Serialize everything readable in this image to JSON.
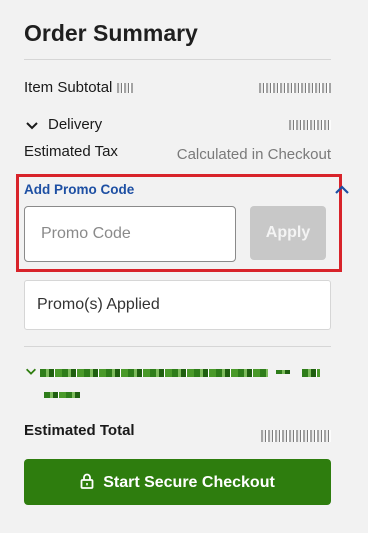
{
  "summary": {
    "title": "Order Summary",
    "item_subtotal_label": "Item Subtotal",
    "delivery_label": "Delivery",
    "estimated_tax_label": "Estimated Tax",
    "estimated_tax_value": "Calculated in Checkout"
  },
  "promo": {
    "title": "Add Promo Code",
    "input_placeholder": "Promo Code",
    "input_value": "",
    "apply_label": "Apply",
    "applied_label": "Promo(s) Applied"
  },
  "total": {
    "label": "Estimated Total"
  },
  "checkout": {
    "label": "Start Secure Checkout"
  },
  "icons": {
    "delivery_toggle": "chevron-down-icon",
    "promo_toggle": "chevron-up-icon",
    "rewards_toggle": "chevron-down-icon",
    "checkout": "lock-icon"
  },
  "colors": {
    "accent_green": "#2e7d0e",
    "link_blue": "#1d4fa3",
    "highlight_red": "#d8232a",
    "disabled_gray": "#c8c8c8"
  }
}
